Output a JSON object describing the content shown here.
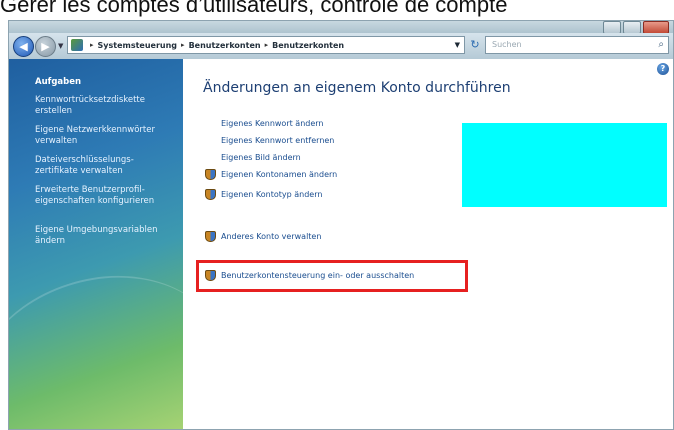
{
  "caption": "Gérer les comptes d’utilisateurs, contrôle de compte",
  "colors": {
    "caption_text": "#111111",
    "sidebar_top": "#1f5fa0",
    "sidebar_bottom": "#a7d374",
    "link": "#1a4d8f",
    "title": "#1d3f73",
    "highlight_border": "#e62020",
    "redaction_block": "#00ffff"
  },
  "navigation": {
    "back_icon": "arrow-left-icon",
    "forward_icon": "arrow-right-icon",
    "breadcrumb": [
      "Systemsteuerung",
      "Benutzerkonten",
      "Benutzerkonten"
    ],
    "refresh_icon": "refresh-icon",
    "search_placeholder": "Suchen"
  },
  "sidebar": {
    "heading": "Aufgaben",
    "items": [
      "Kennwortrücksetzdiskette erstellen",
      "Eigene Netzwerkkennwörter verwalten",
      "Dateiverschlüsselungs-zertifikate verwalten",
      "Erweiterte Benutzerprofil-eigenschaften konfigurieren",
      "Eigene Umgebungsvariablen ändern"
    ]
  },
  "main": {
    "title": "Änderungen an eigenem Konto durchführen",
    "links": [
      {
        "label": "Eigenes Kennwort ändern",
        "shield": false
      },
      {
        "label": "Eigenes Kennwort entfernen",
        "shield": false
      },
      {
        "label": "Eigenes Bild ändern",
        "shield": false
      },
      {
        "label": "Eigenen Kontonamen ändern",
        "shield": true
      },
      {
        "label": "Eigenen Kontotyp ändern",
        "shield": true
      }
    ],
    "secondary_links": [
      {
        "label": "Anderes Konto verwalten",
        "shield": true
      },
      {
        "label": "Benutzerkontensteuerung ein- oder ausschalten",
        "shield": true,
        "highlighted": true
      }
    ]
  }
}
